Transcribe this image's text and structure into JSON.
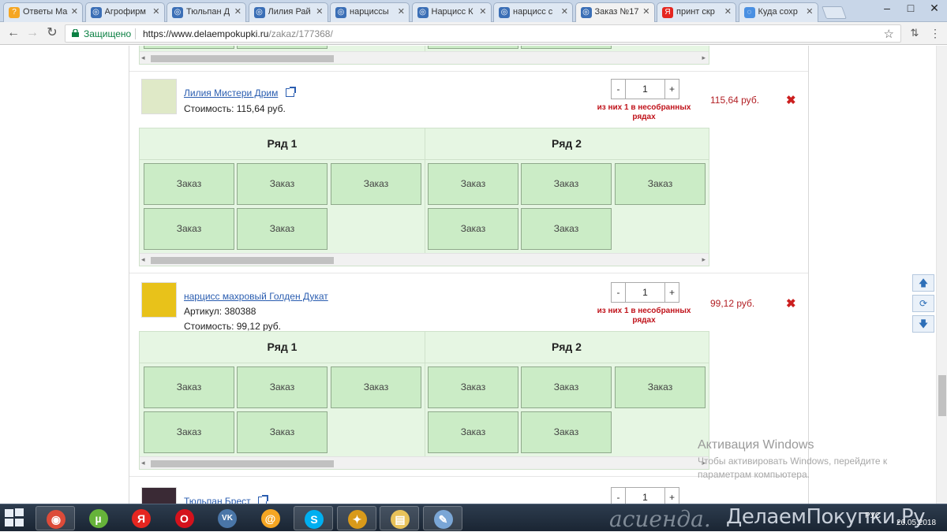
{
  "browser": {
    "tabs": [
      {
        "title": "Ответы Ma",
        "fav": "?",
        "color": "#f5a623"
      },
      {
        "title": "Агрофирм",
        "fav": "◎",
        "color": "#3b6fb6"
      },
      {
        "title": "Тюльпан Д",
        "fav": "◎",
        "color": "#3b6fb6"
      },
      {
        "title": "Лилия Рай",
        "fav": "◎",
        "color": "#3b6fb6"
      },
      {
        "title": "нарциссы",
        "fav": "◎",
        "color": "#3b6fb6"
      },
      {
        "title": "Нарцисс К",
        "fav": "◎",
        "color": "#3b6fb6"
      },
      {
        "title": "нарцисс с",
        "fav": "◎",
        "color": "#3b6fb6"
      },
      {
        "title": "Заказ №17",
        "fav": "◎",
        "color": "#3b6fb6"
      },
      {
        "title": "принт скр",
        "fav": "Я",
        "color": "#e52620"
      },
      {
        "title": "Куда сохр",
        "fav": "◌",
        "color": "#4a90e2"
      }
    ],
    "active_tab": 7,
    "secure_label": "Защищено",
    "url_host": "https://www.delaempokupki.ru",
    "url_path": "/zakaz/177368/"
  },
  "cart": {
    "items": [
      {
        "name": "Лилия Мистери Дрим",
        "article": "",
        "cost_label": "Стоимость: 115,64 руб.",
        "qty": "1",
        "warn": "из них 1 в несобранных рядах",
        "price": "115,64 руб.",
        "thumb_color": "#dfe9c7"
      },
      {
        "name": "нарцисс махровый Голден Дукат",
        "article": "Артикул: 380388",
        "cost_label": "Стоимость: 99,12 руб.",
        "qty": "1",
        "warn": "из них 1 в несобранных рядах",
        "price": "99,12 руб.",
        "thumb_color": "#e8c21a"
      },
      {
        "name": "Тюльпан Брест",
        "article": "",
        "cost_label": "",
        "qty": "1",
        "warn": "",
        "price": "",
        "thumb_color": "#3a2a35"
      }
    ],
    "row_labels": [
      "Ряд 1",
      "Ряд 2"
    ],
    "cell_label": "Заказ",
    "minus": "-",
    "plus": "+",
    "remove_glyph": "✖"
  },
  "watermark": {
    "title": "Активация Windows",
    "text": "Чтобы активировать Windows, перейдите к параметрам компьютера."
  },
  "taskbar": {
    "brand": "ДелаемПокупки.Ру",
    "overlay": "асиенда.",
    "lang": "РУС",
    "date": "26.05.2018",
    "apps": [
      "chrome",
      "utorrent",
      "yandex",
      "opera",
      "vk",
      "mail-agent",
      "skype",
      "game",
      "file-explorer",
      "paint"
    ]
  }
}
